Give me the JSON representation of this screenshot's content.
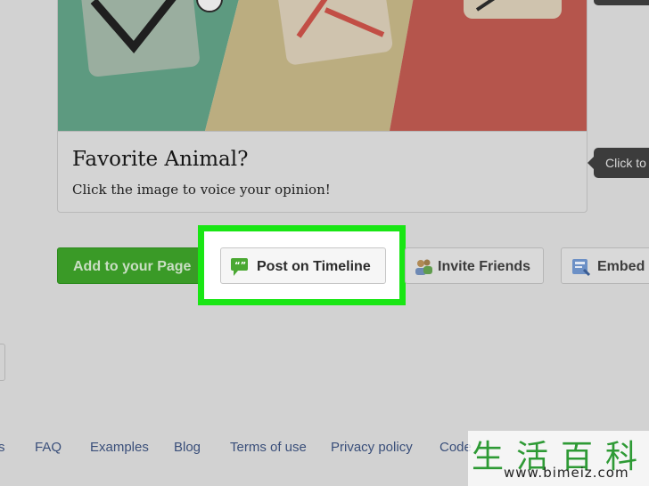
{
  "card": {
    "title": "Favorite Animal?",
    "subtitle": "Click the image to voice your opinion!"
  },
  "tooltip": {
    "text": "Click to"
  },
  "actions": {
    "add_label": "Add to your Page",
    "post_label": "Post on Timeline",
    "invite_label": "Invite Friends",
    "embed_label": "Embed"
  },
  "footer": {
    "links": [
      "s",
      "FAQ",
      "Examples",
      "Blog",
      "Terms of use",
      "Privacy policy",
      "Code"
    ]
  },
  "watermark": {
    "chars": "生活百科",
    "url": "www.bimeiz.com"
  },
  "colors": {
    "highlight": "#19e614",
    "add_button": "#3a9a27",
    "link": "#3a4f7a",
    "panel_green": "#5d9a80",
    "panel_yellow": "#bbad80",
    "panel_red": "#b5554c"
  },
  "icons": [
    "speech-bubble-icon",
    "friends-icon",
    "embed-icon"
  ]
}
